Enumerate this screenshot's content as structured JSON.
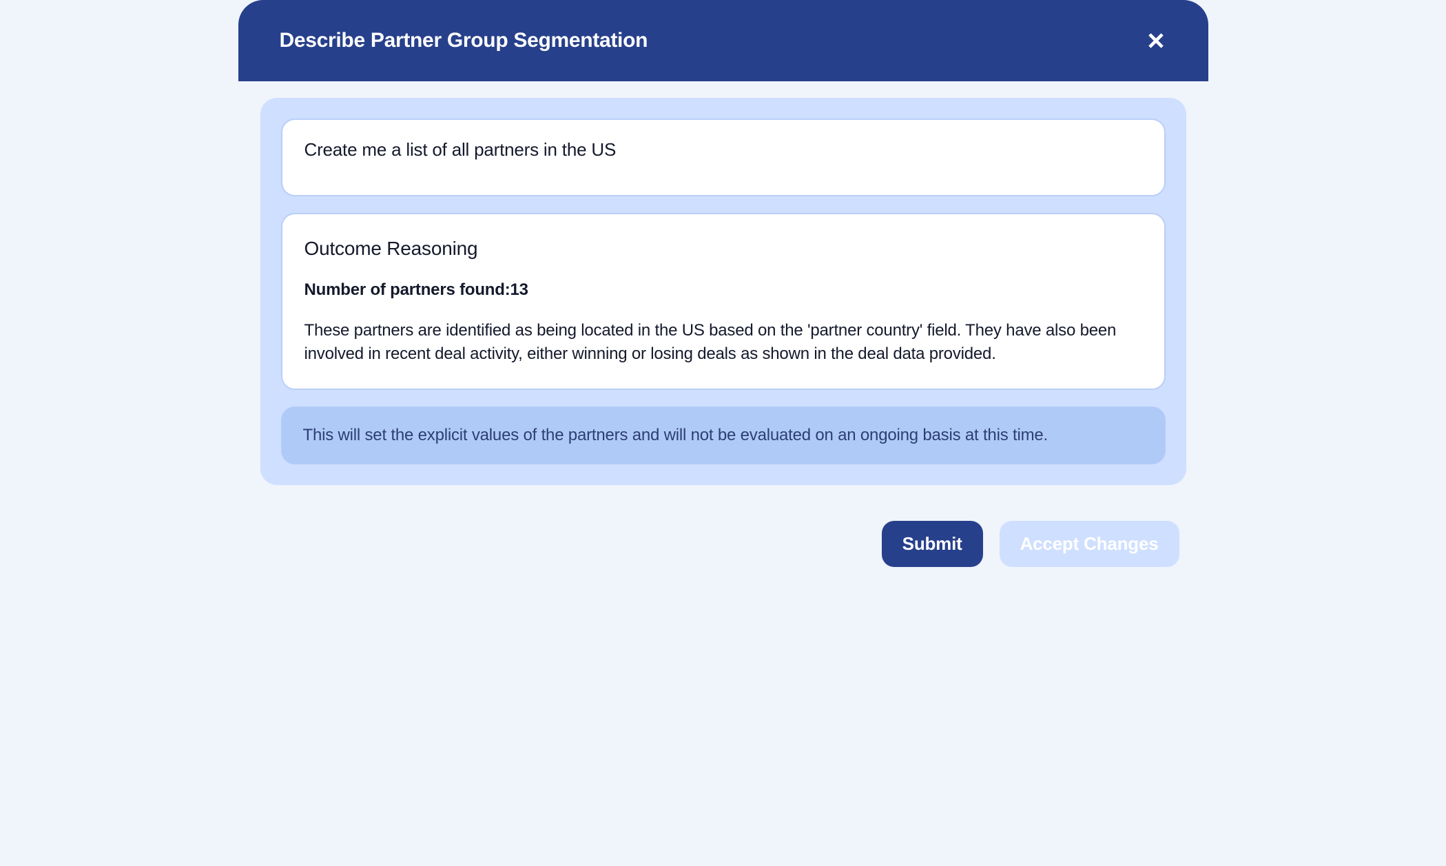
{
  "header": {
    "title": "Describe Partner Group Segmentation"
  },
  "input": {
    "text": "Create me a list of all partners in the US"
  },
  "reasoning": {
    "title": "Outcome Reasoning",
    "partners_found": "Number of partners found:13",
    "description": "These partners are identified as being located in the US based on the 'partner country' field. They have also been involved in recent deal activity, either winning or losing deals as shown in the deal data provided."
  },
  "note": {
    "text": "This will set the explicit values of the partners and will not be evaluated on an ongoing basis at this time."
  },
  "footer": {
    "submit_label": "Submit",
    "accept_label": "Accept Changes"
  }
}
